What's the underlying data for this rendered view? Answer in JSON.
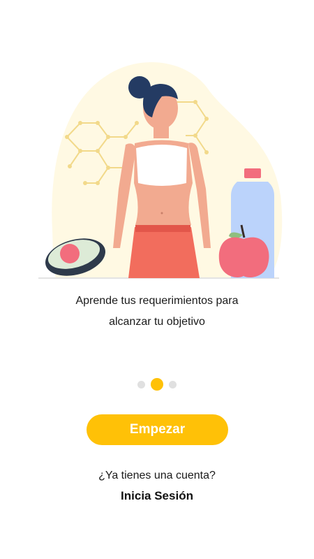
{
  "onboarding": {
    "caption_line1": "Aprende tus requerimientos para",
    "caption_line2": "alcanzar tu objetivo",
    "pages_total": 3,
    "active_page": 2
  },
  "actions": {
    "start_label": "Empezar",
    "account_question": "¿Ya tienes una cuenta?",
    "login_label": "Inicia Sesión"
  },
  "colors": {
    "accent": "#FFC107",
    "dot_inactive": "#E0E0E0",
    "background": "#FFFFFF"
  },
  "illustration": {
    "subject": "woman-fitness-illustration",
    "items": [
      "molecule-icon",
      "avocado-icon",
      "water-bottle-icon",
      "apple-icon"
    ]
  }
}
